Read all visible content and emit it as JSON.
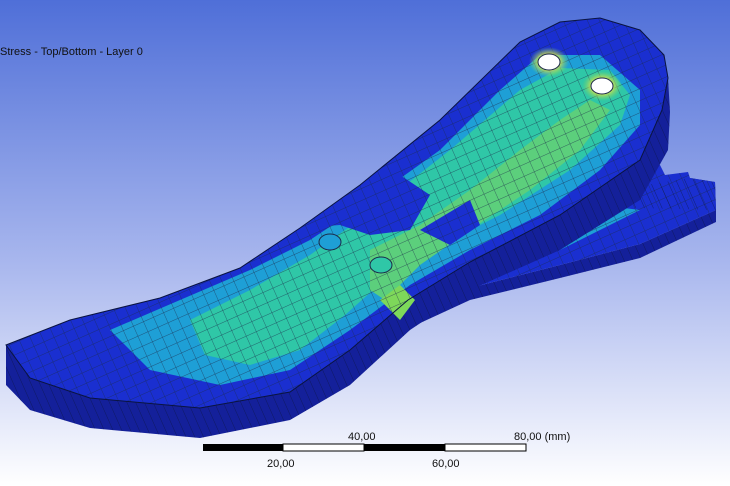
{
  "viewport": {
    "result_title": "Stress - Top/Bottom - Layer 0",
    "colors": {
      "background_top": "#4f6fd8",
      "background_bottom": "#ffffff",
      "low_stress": "#1a2fd0",
      "medium_low": "#1e9fd6",
      "medium": "#2fc7a7",
      "medium_high": "#7ed85a",
      "high": "#e9e34a",
      "peak": "#f19a2a",
      "mesh_line": "#1b2a4a"
    }
  },
  "scale_bar": {
    "labels": {
      "v40": "40,00",
      "v80": "80,00 (mm)",
      "v20": "20,00",
      "v60": "60,00"
    }
  }
}
